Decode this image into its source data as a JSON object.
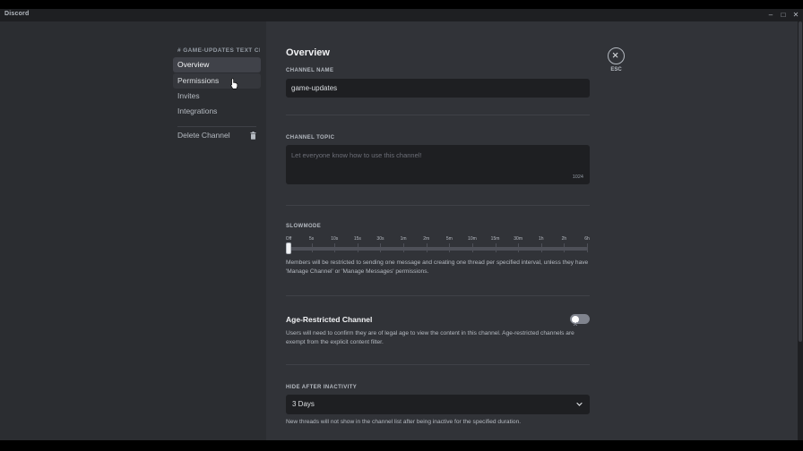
{
  "window": {
    "title": "Discord",
    "controls": [
      "–",
      "□",
      "✕"
    ]
  },
  "sidebar": {
    "header": "# GAME-UPDATES TEXT CH...",
    "items": [
      {
        "label": "Overview",
        "state": "selected"
      },
      {
        "label": "Permissions",
        "state": "hover"
      },
      {
        "label": "Invites",
        "state": "normal"
      },
      {
        "label": "Integrations",
        "state": "normal"
      }
    ],
    "delete_label": "Delete Channel"
  },
  "main": {
    "title": "Overview",
    "close_label": "ESC",
    "channel_name": {
      "label": "CHANNEL NAME",
      "value": "game-updates"
    },
    "channel_topic": {
      "label": "CHANNEL TOPIC",
      "placeholder": "Let everyone know how to use this channel!",
      "counter": "1024"
    },
    "slowmode": {
      "label": "SLOWMODE",
      "marks": [
        "Off",
        "5s",
        "10s",
        "15s",
        "30s",
        "1m",
        "2m",
        "5m",
        "10m",
        "15m",
        "30m",
        "1h",
        "2h",
        "6h"
      ],
      "selected": "Off",
      "description": "Members will be restricted to sending one message and creating one thread per specified interval, unless they have 'Manage Channel' or 'Manage Messages' permissions."
    },
    "age_restricted": {
      "title": "Age-Restricted Channel",
      "enabled": false,
      "description": "Users will need to confirm they are of legal age to view the content in this channel. Age-restricted channels are exempt from the explicit content filter."
    },
    "hide_after_inactivity": {
      "label": "HIDE AFTER INACTIVITY",
      "value": "3 Days",
      "description": "New threads will not show in the channel list after being inactive for the specified duration."
    }
  },
  "colors": {
    "sidebar_bg": "#2b2d31",
    "content_bg": "#313338",
    "input_bg": "#1e1f22",
    "titlebar_bg": "#1e1f22"
  }
}
